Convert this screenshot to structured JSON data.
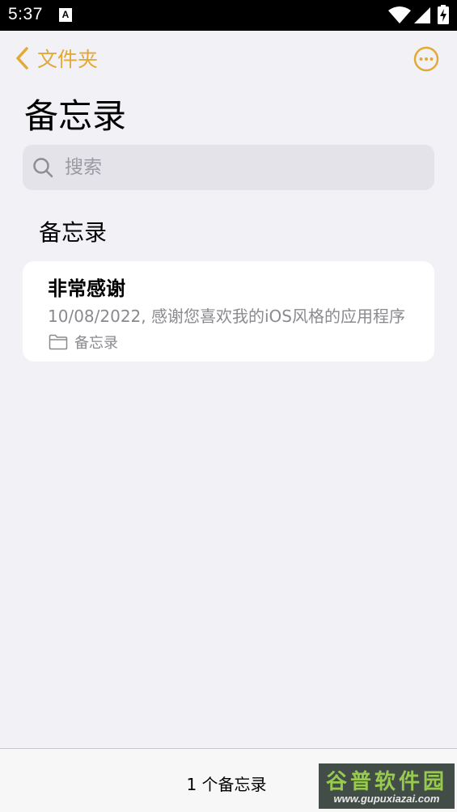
{
  "status_bar": {
    "time": "5:37",
    "notification_icon": "A",
    "icons": [
      "wifi-icon",
      "signal-icon",
      "battery-charging-icon"
    ]
  },
  "nav": {
    "back_label": "文件夹",
    "back_icon": "chevron-left-icon",
    "more_icon": "ellipsis-circle-icon"
  },
  "page": {
    "title": "备忘录"
  },
  "search": {
    "placeholder": "搜索",
    "value": ""
  },
  "section": {
    "header": "备忘录"
  },
  "notes": [
    {
      "title": "非常感谢",
      "preview": "10/08/2022,  感谢您喜欢我的iOS风格的应用程序",
      "folder": "备忘录"
    }
  ],
  "bottom_bar": {
    "count_text": "1 个备忘录"
  },
  "watermark": {
    "line1": "谷普软件园",
    "line2": "www.gupuxiazai.com"
  },
  "colors": {
    "accent": "#e3a936",
    "background": "#f2f1f6",
    "card": "#ffffff",
    "secondary_text": "#8a8a8e",
    "search_bg": "#e4e3ea"
  }
}
